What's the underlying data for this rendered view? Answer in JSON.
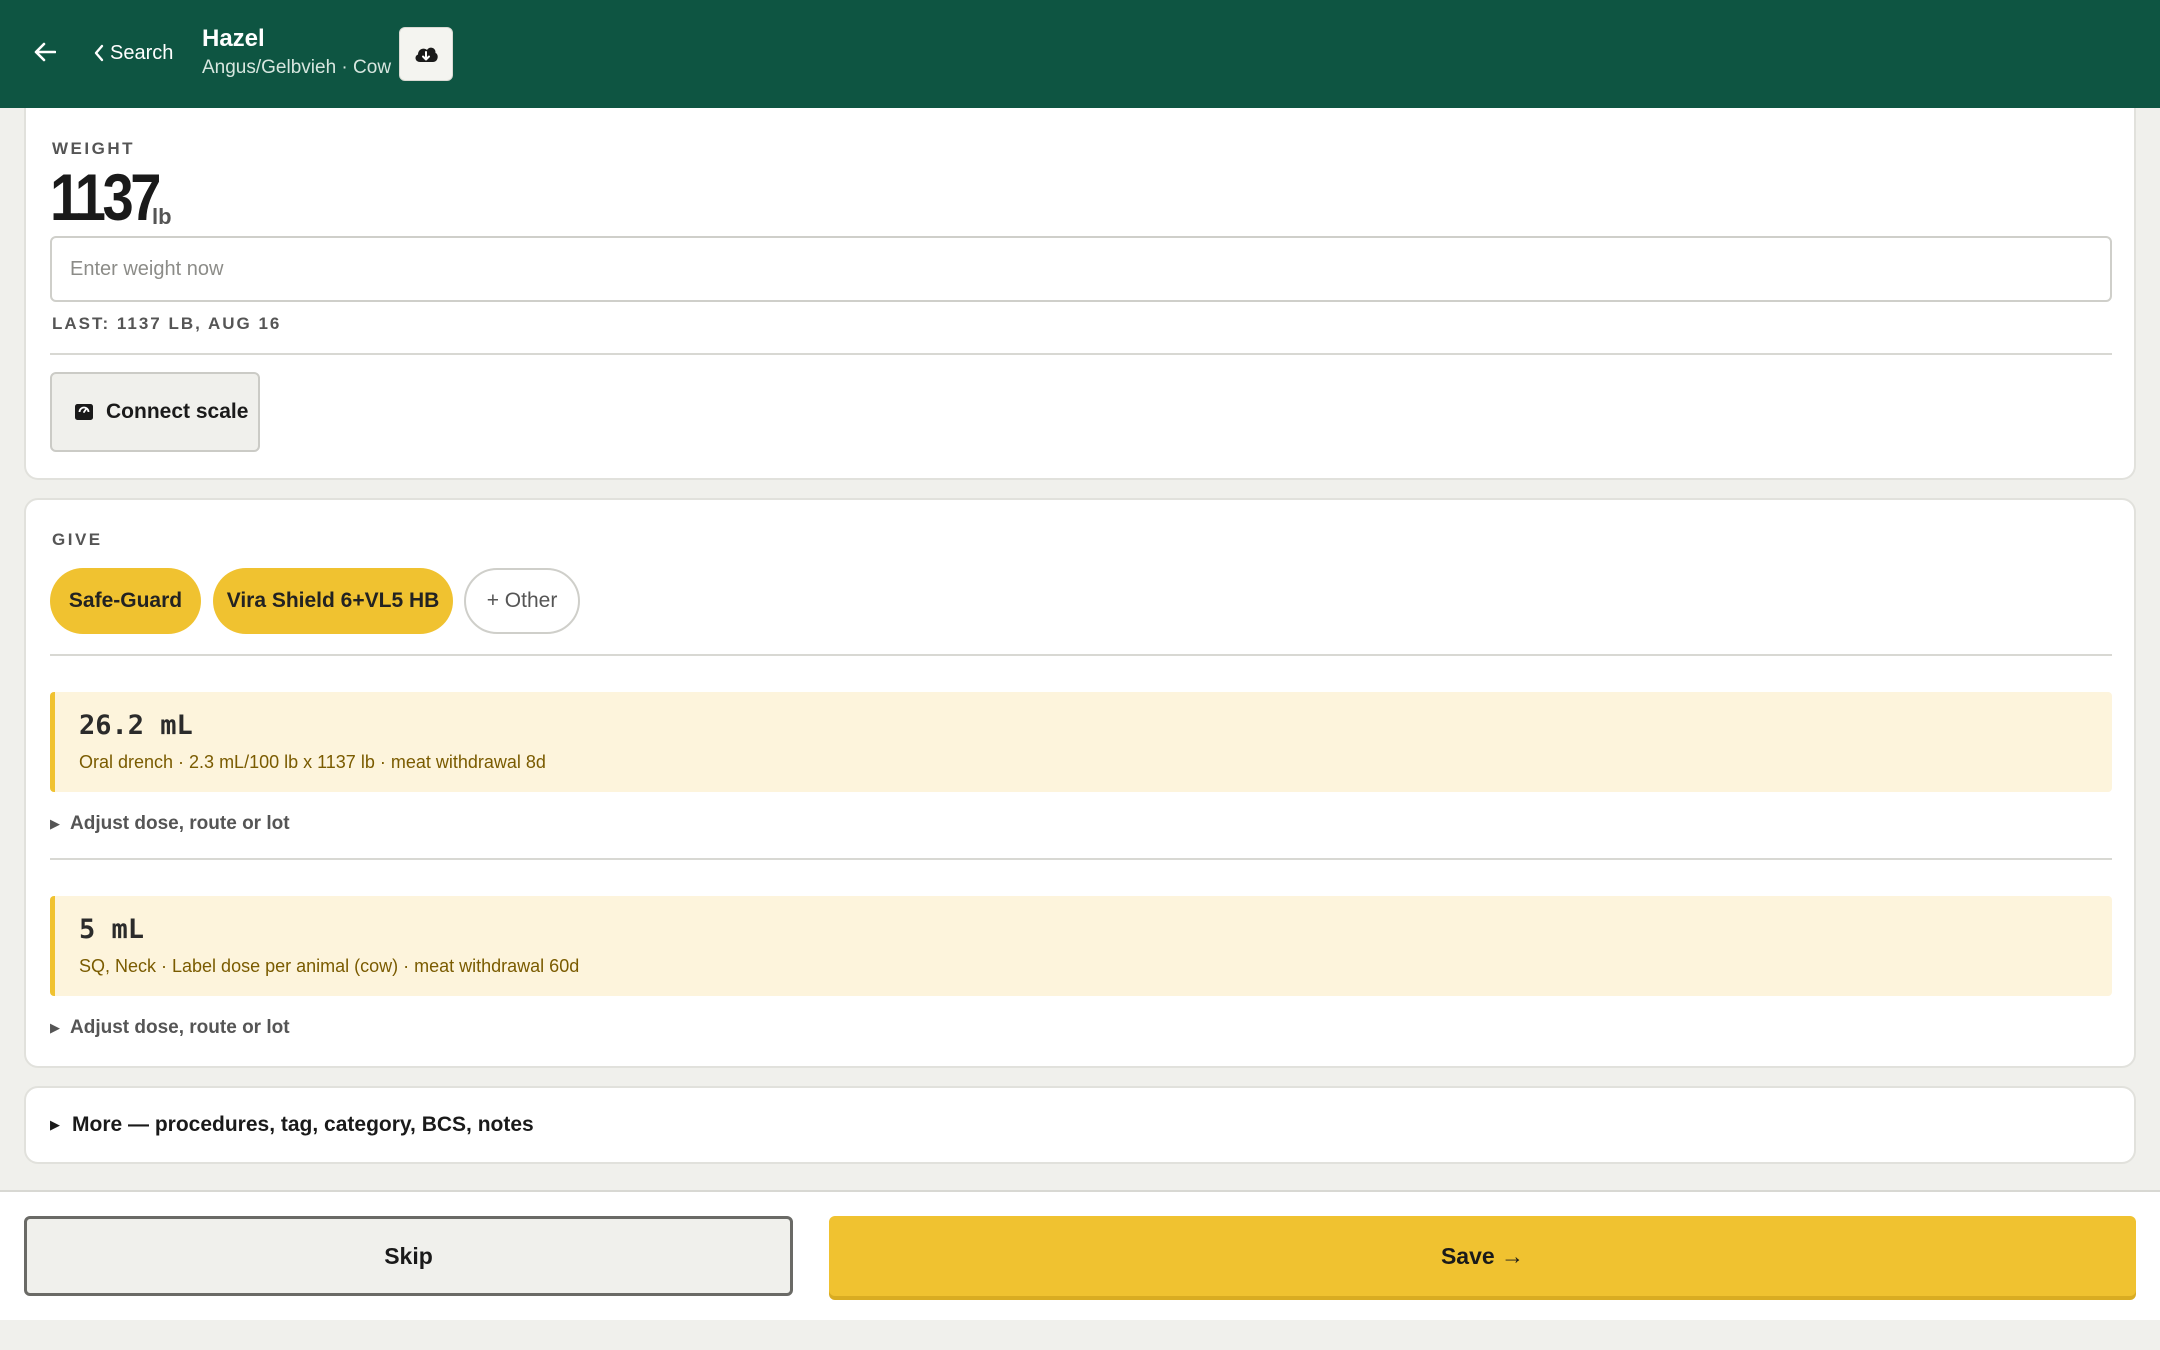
{
  "header": {
    "back_icon": "arrow-left-icon",
    "search_label": "Search",
    "animal_name": "Hazel",
    "animal_subtitle": "Angus/Gelbvieh · Cow",
    "cloud_icon": "cloud-download-icon"
  },
  "weight": {
    "section_label": "WEIGHT",
    "value": "1137",
    "unit": "lb",
    "input_placeholder": "Enter weight now",
    "input_value": "",
    "last_note": "LAST: 1137 LB, AUG 16",
    "scale_button_label": "Connect scale"
  },
  "give": {
    "section_label": "GIVE",
    "chips": [
      {
        "label": "Safe-Guard",
        "selected": true
      },
      {
        "label": "Vira Shield 6+VL5 HB",
        "selected": true
      },
      {
        "label": "+ Other",
        "selected": false
      }
    ],
    "doses": [
      {
        "amount": "26.2 mL",
        "detail": "Oral drench · 2.3 mL/100 lb x 1137 lb · meat withdrawal 8d",
        "adjust_label": "Adjust dose, route or lot"
      },
      {
        "amount": "5 mL",
        "detail": "SQ, Neck · Label dose per animal (cow) · meat withdrawal 60d",
        "adjust_label": "Adjust dose, route or lot"
      }
    ]
  },
  "more": {
    "label": "More — procedures, tag, category, BCS, notes"
  },
  "footer": {
    "skip_label": "Skip",
    "save_label": "Save →"
  },
  "colors": {
    "header_bg": "#0e5542",
    "accent_yellow": "#f0c230",
    "dose_bg": "#fdf4dc"
  }
}
